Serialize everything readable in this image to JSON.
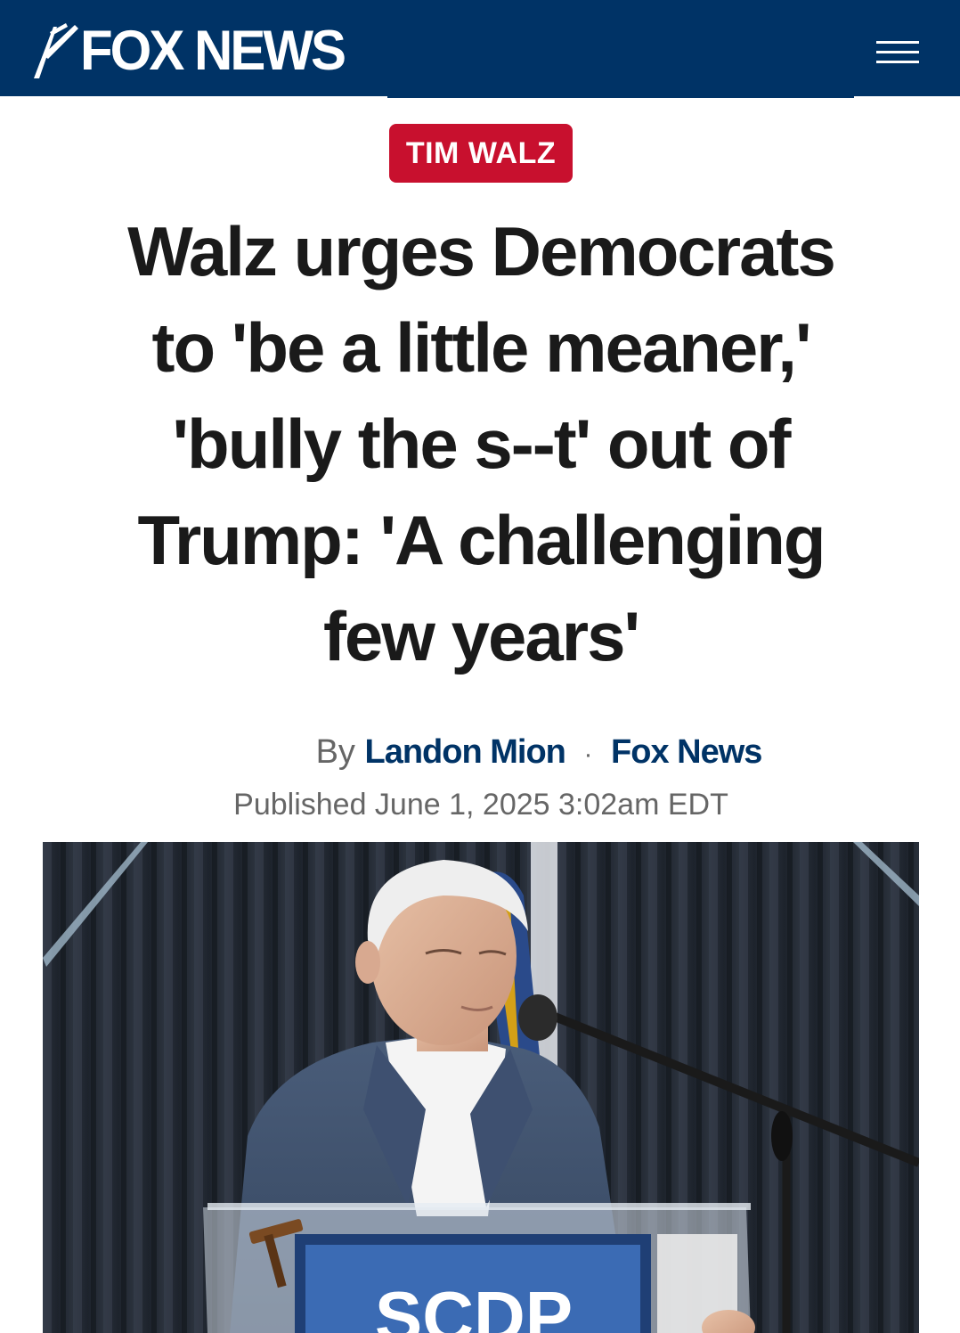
{
  "header": {
    "logo_text": "FOX NEWS",
    "menu_icon": "hamburger-menu-icon",
    "background_color": "#003366"
  },
  "article": {
    "category": "TIM WALZ",
    "category_color": "#c8102e",
    "headline_lines": [
      "Walz urges Democrats",
      "to 'be a little meaner,'",
      "'bully the s--t' out of",
      "Trump: 'A challenging",
      "few years'"
    ],
    "byline_prefix": "By",
    "author": "Landon Mion",
    "separator": "·",
    "source": "Fox News",
    "published": "Published June 1, 2025 3:02am EDT",
    "photo_sign_text": "SCDP"
  }
}
